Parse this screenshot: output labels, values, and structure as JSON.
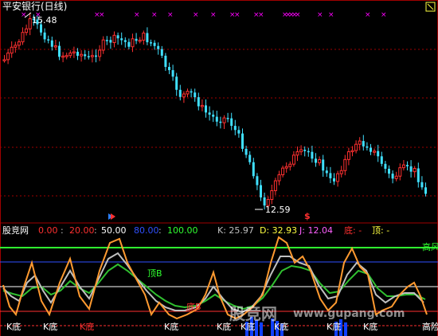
{
  "main_panel": {
    "title": "平安银行(日线)",
    "high_label": "15.48",
    "low_label": "12.59",
    "signal_marker": "$",
    "colors": {
      "up": "#ff3030",
      "down": "#40e0ff",
      "marker": "#ff00ff",
      "dash": "#a00000"
    }
  },
  "indicator_panel": {
    "name": "股竞网",
    "params": [
      {
        "text": "0.00",
        "color": "#ff3030"
      },
      {
        "text": "20.00",
        "color": "#ff3030"
      },
      {
        "text": "50.00",
        "color": "#ffffff"
      },
      {
        "text": "80.00",
        "color": "#3050ff"
      },
      {
        "text": "100.00",
        "color": "#30ff30"
      }
    ],
    "kdj": [
      {
        "text": "K: 25.97",
        "color": "#c0c0c0"
      },
      {
        "text": "D: 32.93",
        "color": "#ffff40"
      },
      {
        "text": "J: 12.04",
        "color": "#ff60ff"
      }
    ],
    "di_text": "底: -",
    "ding_text": "顶: -",
    "label_high_risk": "高风",
    "label_high_risk_2": "高险",
    "label_top_b": "顶B",
    "label_bottom_b": "底B",
    "k_di_labels": [
      "K底",
      "K底",
      "K底",
      "K底",
      "K底",
      "K底",
      "K底",
      "K底",
      "K底"
    ],
    "watermark": "股竞网",
    "watermark_url": "www.gupang.com"
  }
}
